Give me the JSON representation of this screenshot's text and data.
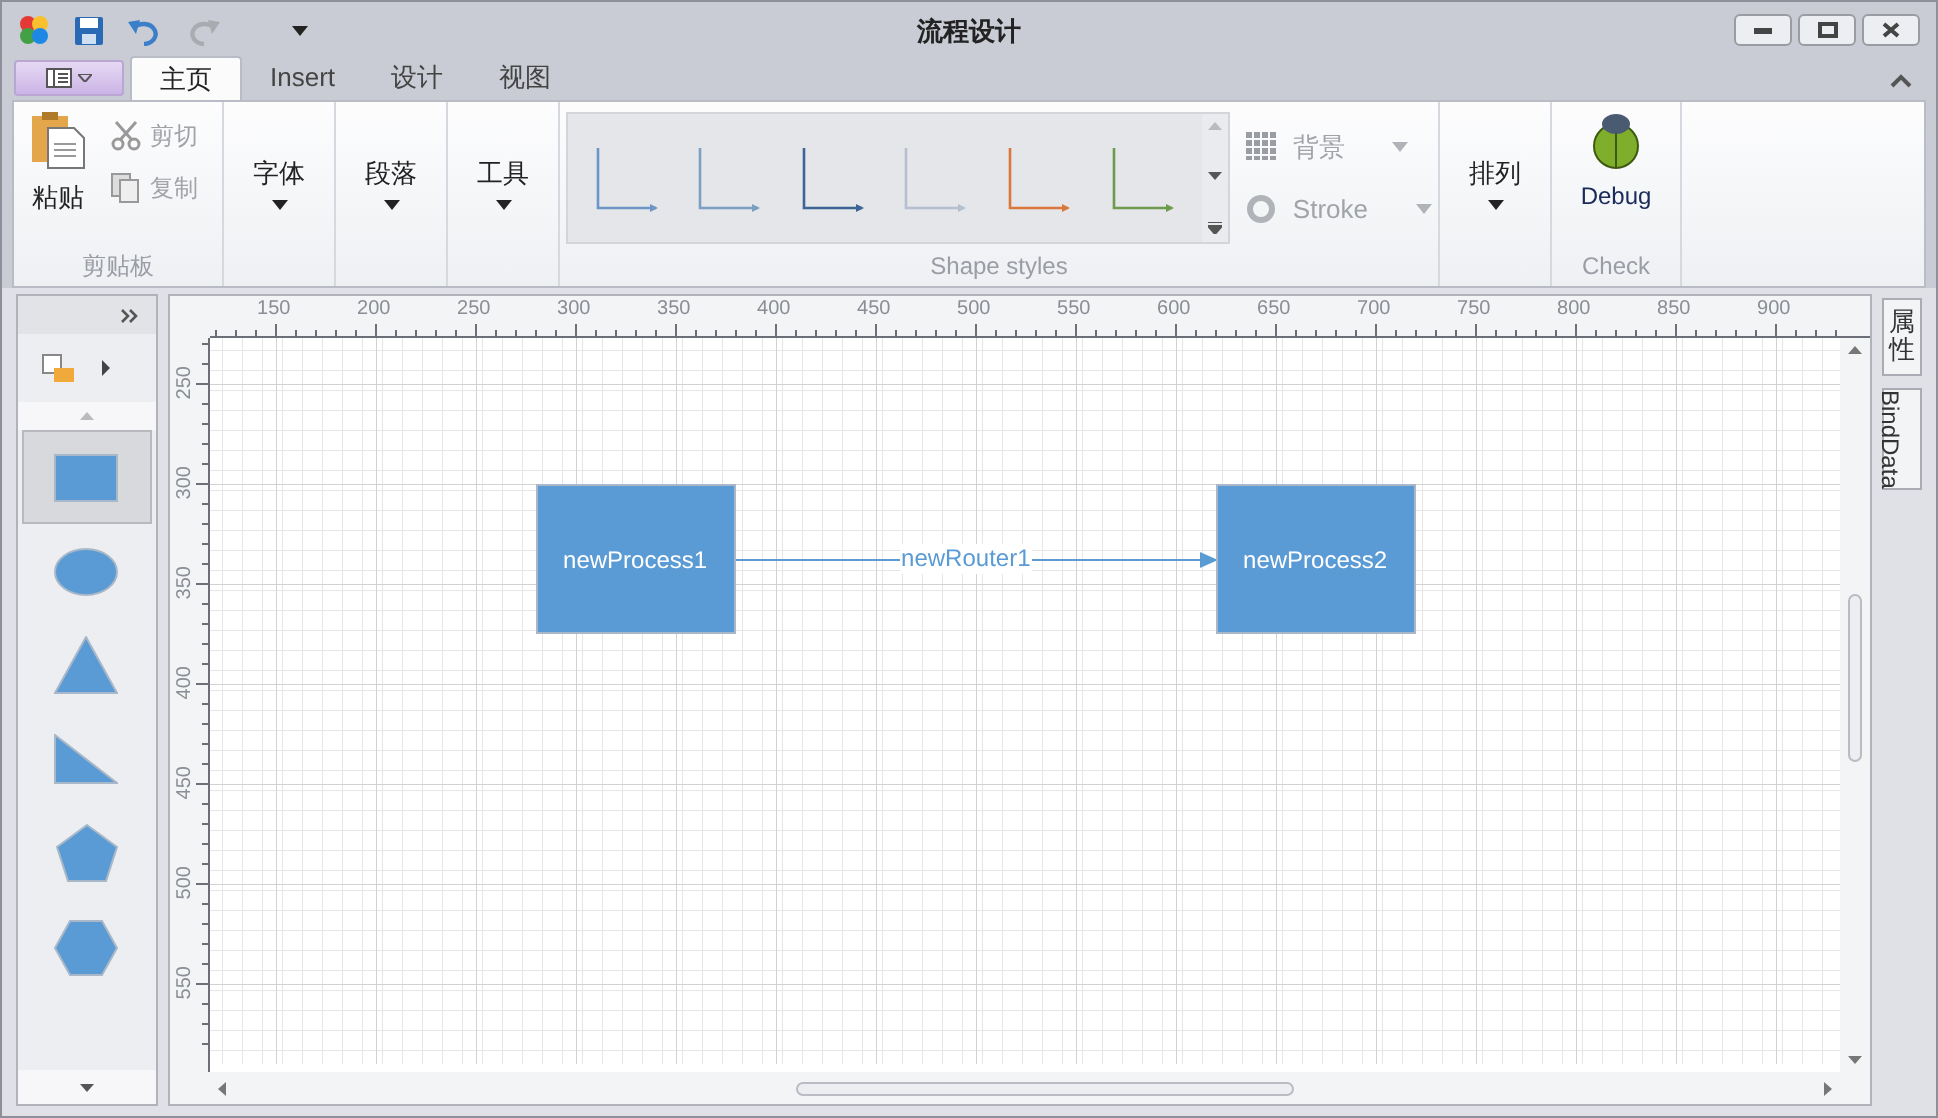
{
  "window": {
    "title": "流程设计"
  },
  "quick_access": {
    "redo_disabled": true
  },
  "tabs": [
    {
      "label": "主页",
      "selected": true
    },
    {
      "label": "Insert",
      "selected": false
    },
    {
      "label": "设计",
      "selected": false
    },
    {
      "label": "视图",
      "selected": false
    }
  ],
  "ribbon": {
    "groups": [
      {
        "kind": "clipboard",
        "label": "剪贴板",
        "paste": "粘贴",
        "cut": {
          "label": "剪切",
          "disabled": true
        },
        "copy": {
          "label": "复制",
          "disabled": true
        }
      },
      {
        "kind": "dropdown",
        "button": "字体"
      },
      {
        "kind": "dropdown",
        "button": "段落"
      },
      {
        "kind": "dropdown",
        "button": "工具"
      },
      {
        "kind": "gallery",
        "label": "Shape styles",
        "styles": [
          {
            "color": "#6b96c6"
          },
          {
            "color": "#7c9fc4"
          },
          {
            "color": "#3d6496"
          },
          {
            "color": "#b4c0cf"
          },
          {
            "color": "#d9783a"
          },
          {
            "color": "#6f9b4c"
          }
        ],
        "background": {
          "label": "背景",
          "disabled": true
        },
        "stroke": {
          "label": "Stroke",
          "disabled": true
        }
      },
      {
        "kind": "dropdown",
        "button": "排列"
      },
      {
        "kind": "debug",
        "button": "Debug",
        "label": "Check"
      }
    ]
  },
  "toolbox": {
    "shapes": [
      {
        "kind": "rectangle",
        "selected": true
      },
      {
        "kind": "ellipse",
        "selected": false
      },
      {
        "kind": "triangle",
        "selected": false
      },
      {
        "kind": "right-triangle",
        "selected": false
      },
      {
        "kind": "pentagon",
        "selected": false
      },
      {
        "kind": "hexagon",
        "selected": false
      }
    ]
  },
  "ruler": {
    "x_labels": [
      "150",
      "200",
      "250",
      "300",
      "350",
      "400",
      "450",
      "500",
      "550",
      "600",
      "650",
      "700",
      "750",
      "800",
      "850",
      "900"
    ],
    "y_labels": [
      "250",
      "300",
      "350",
      "400",
      "450",
      "500",
      "550"
    ]
  },
  "diagram": {
    "nodes": [
      {
        "label": "newProcess1"
      },
      {
        "label": "newProcess2"
      }
    ],
    "edges": [
      {
        "label": "newRouter1"
      }
    ]
  },
  "side_tabs": [
    {
      "label": "属性",
      "kind": "cjk"
    },
    {
      "label": "BindData",
      "kind": "latin"
    }
  ]
}
